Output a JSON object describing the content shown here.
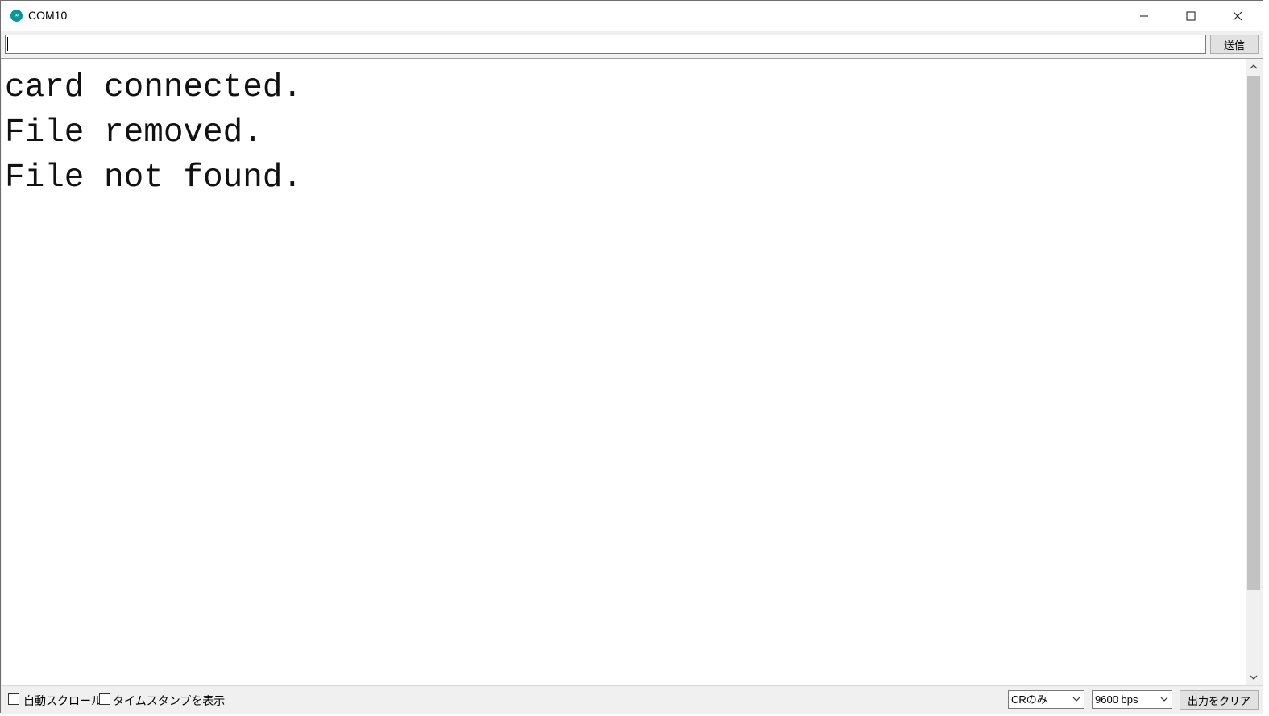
{
  "window": {
    "title": "COM10",
    "app_icon": "arduino-icon",
    "controls": {
      "minimize_icon": "minimize-icon",
      "maximize_icon": "maximize-icon",
      "close_icon": "close-icon"
    }
  },
  "send": {
    "input_value": "",
    "button_label": "送信"
  },
  "output": {
    "lines": [
      "card connected.",
      "File removed.",
      "File not found."
    ]
  },
  "footer": {
    "autoscroll": {
      "label": "自動スクロール",
      "checked": false
    },
    "timestamp": {
      "label": "タイムスタンプを表示",
      "checked": false
    },
    "line_ending": {
      "selected": "CRのみ"
    },
    "baud_rate": {
      "selected": "9600 bps"
    },
    "clear_button_label": "出力をクリア"
  },
  "colors": {
    "app_icon": "#00979d",
    "scroll_thumb": "#c2c2c2",
    "chrome": "#f0f0f0"
  }
}
